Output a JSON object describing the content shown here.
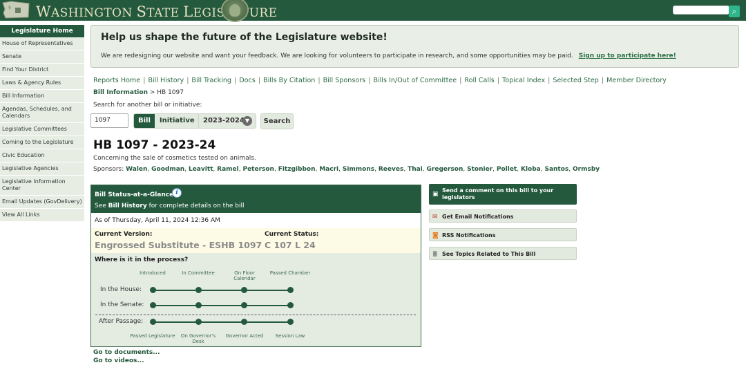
{
  "header": {
    "site_title": "Washington State Legislature",
    "search_button_icon": "search-icon"
  },
  "sidebar": {
    "home": "Legislature Home",
    "items": [
      "House of Representatives",
      "Senate",
      "Find Your District",
      "Laws & Agency Rules",
      "Bill Information",
      "Agendas, Schedules, and Calendars",
      "Legislative Committees",
      "Coming to the Legislature",
      "Civic Education",
      "Legislative Agencies",
      "Legislative Information Center",
      "Email Updates (GovDelivery)",
      "View All Links"
    ]
  },
  "banner": {
    "title": "Help us shape the future of the Legislature website!",
    "text": "We are redesigning our website and want your feedback. We are looking for volunteers to participate in research, and some opportunities may be paid.",
    "link": "Sign up to participate here!"
  },
  "topnav": [
    "Reports Home",
    "Bill History",
    "Bill Tracking",
    "Docs",
    "Bills By Citation",
    "Bill Sponsors",
    "Bills In/Out of Committee",
    "Roll Calls",
    "Topical Index",
    "Selected Step",
    "Member Directory"
  ],
  "breadcrumb": {
    "link": "Bill Information",
    "current": "> HB 1097"
  },
  "search": {
    "label": "Search for another bill or initiative:",
    "value": "1097",
    "toggle_bill": "Bill",
    "toggle_initiative": "Initiative",
    "session": "2023-2024",
    "button": "Search"
  },
  "bill": {
    "title": "HB 1097 - 2023-24",
    "description": "Concerning the sale of cosmetics tested on animals.",
    "sponsors_label": "Sponsors:",
    "sponsors": [
      "Walen",
      "Goodman",
      "Leavitt",
      "Ramel",
      "Peterson",
      "Fitzgibbon",
      "Macri",
      "Simmons",
      "Reeves",
      "Thai",
      "Gregerson",
      "Stonier",
      "Pollet",
      "Kloba",
      "Santos",
      "Ormsby"
    ]
  },
  "status": {
    "title": "Bill Status-at-a-Glance",
    "sub_prefix": "See",
    "sub_link": "Bill History",
    "sub_suffix": "for complete details on the bill",
    "as_of": "As of Thursday, April 11, 2024 12:36 AM",
    "current_version_label": "Current Version:",
    "current_version": "Engrossed Substitute - ESHB 1097",
    "current_status_label": "Current Status:",
    "current_status": "C 107 L 24",
    "process_label": "Where is it in the process?",
    "stages": [
      "Introduced",
      "In Committee",
      "On Floor Calendar",
      "Passed Chamber"
    ],
    "rows": [
      "In the House:",
      "In the Senate:",
      "After Passage:"
    ],
    "after_stages": [
      "Passed Legislature",
      "On Governor's Desk",
      "Governor Acted",
      "Session Law"
    ]
  },
  "doc_links": [
    "Go to documents...",
    "Go to videos..."
  ],
  "actions": [
    {
      "label": "Send a comment on this bill to your legislators",
      "icon": "comment-icon"
    },
    {
      "label": "Get Email Notifications",
      "icon": "email-icon"
    },
    {
      "label": "RSS Notifications",
      "icon": "rss-icon"
    },
    {
      "label": "See Topics Related to This Bill",
      "icon": "topics-icon"
    }
  ]
}
